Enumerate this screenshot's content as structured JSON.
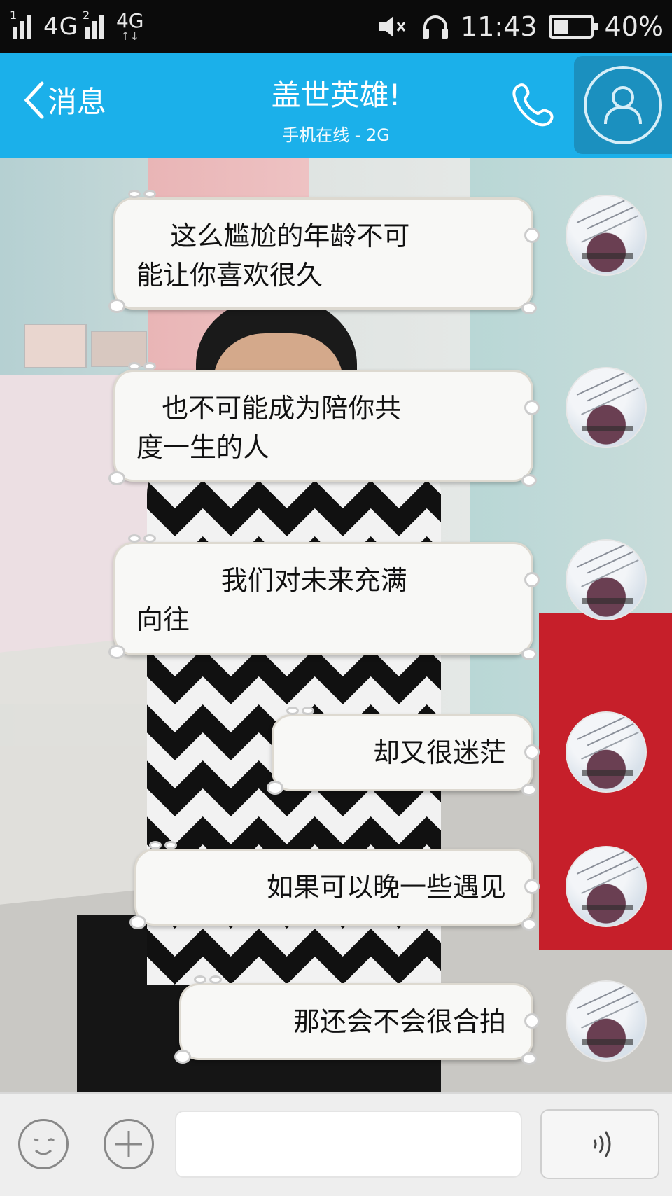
{
  "status_bar": {
    "sim1_label": "1",
    "sim2_label": "2",
    "network_1": "4G",
    "network_2": "4G",
    "time": "11:43",
    "battery": "40%",
    "battery_level": 0.4,
    "icons": [
      "signal-icon",
      "signal-icon",
      "mute-icon",
      "headset-icon",
      "battery-icon"
    ]
  },
  "header": {
    "back_label": "消息",
    "title": "盖世英雄!",
    "subtitle": "手机在线 - 2G",
    "accent": "#1bb0ea",
    "icons": [
      "back-chevron-icon",
      "phone-icon",
      "profile-icon"
    ]
  },
  "messages": [
    {
      "text": "    这么尴尬的年龄不可\n能让你喜欢很久"
    },
    {
      "text": "   也不可能成为陪你共\n度一生的人"
    },
    {
      "text": "          我们对未来充满\n向往"
    },
    {
      "text": "却又很迷茫"
    },
    {
      "text": "如果可以晚一些遇见"
    },
    {
      "text": "那还会不会很合拍"
    }
  ],
  "input_bar": {
    "placeholder": "",
    "icons": [
      "emoji-icon",
      "plus-icon",
      "voice-icon"
    ]
  }
}
